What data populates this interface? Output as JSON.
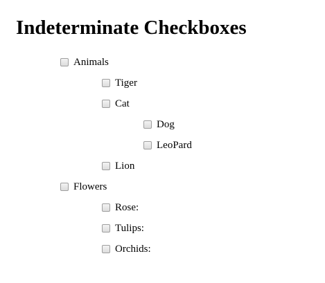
{
  "page": {
    "title": "Indeterminate Checkboxes"
  },
  "tree": {
    "animals": {
      "label": "Animals",
      "tiger": "Tiger",
      "cat": "Cat",
      "dog": "Dog",
      "leopard": "LeoPard",
      "lion": "Lion"
    },
    "flowers": {
      "label": "Flowers",
      "rose": "Rose:",
      "tulips": "Tulips:",
      "orchids": "Orchids:"
    }
  },
  "state": {
    "all_checked": false
  }
}
